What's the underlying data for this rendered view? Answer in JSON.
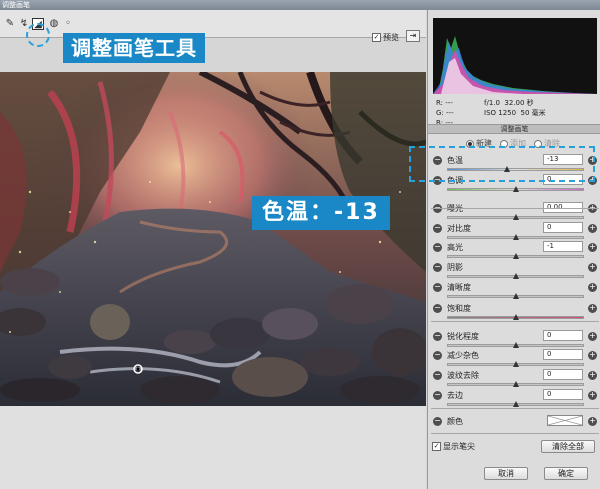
{
  "window": {
    "title": "调整画笔"
  },
  "toolbar": {
    "tools": [
      "eyedropper-icon",
      "color-sampler-icon",
      "brush-icon",
      "erase-icon",
      "dropper-small-icon"
    ],
    "active_tool": "adjustment-brush-icon",
    "callout_label": "调整画笔工具",
    "preview_label": "预览",
    "preview_checked": true
  },
  "canvas": {
    "callout_label": "色温：-13"
  },
  "histogram_info": {
    "r_label": "R:",
    "r_value": "---",
    "g_label": "G:",
    "g_value": "---",
    "b_label": "B:",
    "b_value": "---",
    "aperture": "f/1.0",
    "shutter": "32.00 秒",
    "iso": "ISO 1250",
    "focal": "50 毫米"
  },
  "panel": {
    "title": "调整画笔",
    "modes": [
      {
        "label": "新建",
        "selected": true
      },
      {
        "label": "添加",
        "selected": false
      },
      {
        "label": "清除",
        "selected": false
      }
    ],
    "sliders": [
      {
        "label": "色温",
        "value": "-13",
        "position": 0.435
      },
      {
        "label": "色调",
        "value": "0",
        "position": 0.5
      },
      {
        "label": "曝光",
        "value": "0.00",
        "position": 0.5
      },
      {
        "label": "对比度",
        "value": "0",
        "position": 0.5
      },
      {
        "label": "高光",
        "value": "-1",
        "position": 0.5
      },
      {
        "label": "阴影",
        "value": "",
        "position": 0.5
      },
      {
        "label": "清晰度",
        "value": "",
        "position": 0.5
      },
      {
        "label": "饱和度",
        "value": "",
        "position": 0.5
      },
      {
        "label": "锐化程度",
        "value": "0",
        "position": 0.5
      },
      {
        "label": "减少杂色",
        "value": "0",
        "position": 0.5
      },
      {
        "label": "波纹去除",
        "value": "0",
        "position": 0.5
      },
      {
        "label": "去边",
        "value": "0",
        "position": 0.5
      }
    ],
    "color_label": "颜色",
    "show_pins_label": "显示笔尖",
    "show_pins_checked": true,
    "clear_all_label": "清除全部"
  },
  "footer": {
    "cancel_label": "取消",
    "ok_label": "确定"
  },
  "colors": {
    "accent": "#1a88c6",
    "panel_bg": "#dcdcdc"
  }
}
